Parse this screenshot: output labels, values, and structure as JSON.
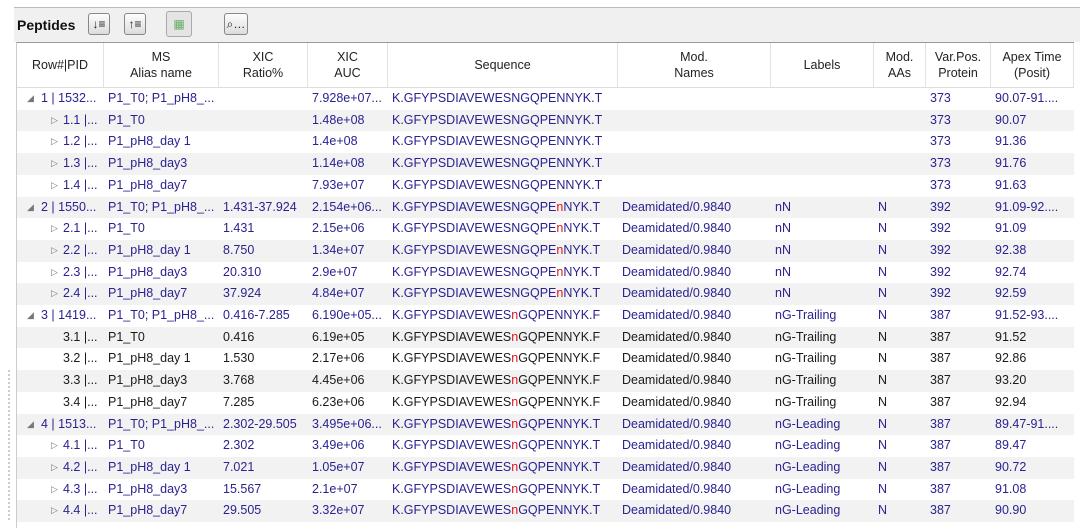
{
  "panel": {
    "title": "Peptides",
    "buttons": [
      {
        "name": "expand-all-button",
        "glyph": "↓≡"
      },
      {
        "name": "collapse-all-button",
        "glyph": "↑≡"
      },
      {
        "name": "export-button",
        "glyph": "▦"
      },
      {
        "name": "find-button",
        "glyph": "⌕…"
      }
    ]
  },
  "columns": [
    "Row#|PID",
    "MS\nAlias name",
    "XIC\nRatio%",
    "XIC\nAUC",
    "Sequence",
    "Mod.\nNames",
    "Labels",
    "Mod.\nAAs",
    "Var.Pos.\nProtein",
    "Apex Time\n(Posit)"
  ],
  "colors": {
    "text": "#2a2290",
    "mod": "#e0141e"
  },
  "rows": [
    {
      "level": 0,
      "expanded": true,
      "id": "1 | 1532...",
      "alias": "P1_T0; P1_pH8_...",
      "ratio": "",
      "auc": "7.928e+07...",
      "seq_pre": "K.GFYPSDIAVEWESNGQPENNYK.T",
      "seq_mod": "",
      "seq_post": "",
      "modnames": "",
      "labels": "",
      "modaas": "",
      "varpos": "373",
      "apex": "90.07-91...."
    },
    {
      "level": 1,
      "id": "1.1 |...",
      "alias": "P1_T0",
      "ratio": "",
      "auc": "1.48e+08",
      "seq_pre": "K.GFYPSDIAVEWESNGQPENNYK.T",
      "seq_mod": "",
      "seq_post": "",
      "modnames": "",
      "labels": "",
      "modaas": "",
      "varpos": "373",
      "apex": "90.07"
    },
    {
      "level": 1,
      "id": "1.2 |...",
      "alias": "P1_pH8_day 1",
      "ratio": "",
      "auc": "1.4e+08",
      "seq_pre": "K.GFYPSDIAVEWESNGQPENNYK.T",
      "seq_mod": "",
      "seq_post": "",
      "modnames": "",
      "labels": "",
      "modaas": "",
      "varpos": "373",
      "apex": "91.36"
    },
    {
      "level": 1,
      "id": "1.3 |...",
      "alias": "P1_pH8_day3",
      "ratio": "",
      "auc": "1.14e+08",
      "seq_pre": "K.GFYPSDIAVEWESNGQPENNYK.T",
      "seq_mod": "",
      "seq_post": "",
      "modnames": "",
      "labels": "",
      "modaas": "",
      "varpos": "373",
      "apex": "91.76"
    },
    {
      "level": 1,
      "id": "1.4 |...",
      "alias": "P1_pH8_day7",
      "ratio": "",
      "auc": "7.93e+07",
      "seq_pre": "K.GFYPSDIAVEWESNGQPENNYK.T",
      "seq_mod": "",
      "seq_post": "",
      "modnames": "",
      "labels": "",
      "modaas": "",
      "varpos": "373",
      "apex": "91.63"
    },
    {
      "level": 0,
      "expanded": true,
      "id": "2 | 1550...",
      "alias": "P1_T0; P1_pH8_...",
      "ratio": "1.431-37.924",
      "auc": "2.154e+06...",
      "seq_pre": "K.GFYPSDIAVEWESNGQPE",
      "seq_mod": "n",
      "seq_post": "NYK.T",
      "modnames": "Deamidated/0.9840",
      "labels": "nN",
      "modaas": "N",
      "varpos": "392",
      "apex": "91.09-92...."
    },
    {
      "level": 1,
      "id": "2.1 |...",
      "alias": "P1_T0",
      "ratio": "1.431",
      "auc": "2.15e+06",
      "seq_pre": "K.GFYPSDIAVEWESNGQPE",
      "seq_mod": "n",
      "seq_post": "NYK.T",
      "modnames": "Deamidated/0.9840",
      "labels": "nN",
      "modaas": "N",
      "varpos": "392",
      "apex": "91.09"
    },
    {
      "level": 1,
      "id": "2.2 |...",
      "alias": "P1_pH8_day 1",
      "ratio": "8.750",
      "auc": "1.34e+07",
      "seq_pre": "K.GFYPSDIAVEWESNGQPE",
      "seq_mod": "n",
      "seq_post": "NYK.T",
      "modnames": "Deamidated/0.9840",
      "labels": "nN",
      "modaas": "N",
      "varpos": "392",
      "apex": "92.38"
    },
    {
      "level": 1,
      "id": "2.3 |...",
      "alias": "P1_pH8_day3",
      "ratio": "20.310",
      "auc": "2.9e+07",
      "seq_pre": "K.GFYPSDIAVEWESNGQPE",
      "seq_mod": "n",
      "seq_post": "NYK.T",
      "modnames": "Deamidated/0.9840",
      "labels": "nN",
      "modaas": "N",
      "varpos": "392",
      "apex": "92.74"
    },
    {
      "level": 1,
      "id": "2.4 |...",
      "alias": "P1_pH8_day7",
      "ratio": "37.924",
      "auc": "4.84e+07",
      "seq_pre": "K.GFYPSDIAVEWESNGQPE",
      "seq_mod": "n",
      "seq_post": "NYK.T",
      "modnames": "Deamidated/0.9840",
      "labels": "nN",
      "modaas": "N",
      "varpos": "392",
      "apex": "92.59"
    },
    {
      "level": 0,
      "expanded": true,
      "id": "3 | 1419...",
      "alias": "P1_T0; P1_pH8_...",
      "ratio": "0.416-7.285",
      "auc": "6.190e+05...",
      "seq_pre": "K.GFYPSDIAVEWES",
      "seq_mod": "n",
      "seq_post": "GQPENNYK.F",
      "modnames": "Deamidated/0.9840",
      "labels": "nG-Trailing",
      "modaas": "N",
      "varpos": "387",
      "apex": "91.52-93...."
    },
    {
      "level": 1,
      "black": true,
      "noarrow": true,
      "id": "3.1 |...",
      "alias": "P1_T0",
      "ratio": "0.416",
      "auc": "6.19e+05",
      "seq_pre": "K.GFYPSDIAVEWES",
      "seq_mod": "n",
      "seq_post": "GQPENNYK.F",
      "modnames": "Deamidated/0.9840",
      "labels": "nG-Trailing",
      "modaas": "N",
      "varpos": "387",
      "apex": "91.52"
    },
    {
      "level": 1,
      "black": true,
      "noarrow": true,
      "id": "3.2 |...",
      "alias": "P1_pH8_day 1",
      "ratio": "1.530",
      "auc": "2.17e+06",
      "seq_pre": "K.GFYPSDIAVEWES",
      "seq_mod": "n",
      "seq_post": "GQPENNYK.F",
      "modnames": "Deamidated/0.9840",
      "labels": "nG-Trailing",
      "modaas": "N",
      "varpos": "387",
      "apex": "92.86"
    },
    {
      "level": 1,
      "black": true,
      "noarrow": true,
      "id": "3.3 |...",
      "alias": "P1_pH8_day3",
      "ratio": "3.768",
      "auc": "4.45e+06",
      "seq_pre": "K.GFYPSDIAVEWES",
      "seq_mod": "n",
      "seq_post": "GQPENNYK.F",
      "modnames": "Deamidated/0.9840",
      "labels": "nG-Trailing",
      "modaas": "N",
      "varpos": "387",
      "apex": "93.20"
    },
    {
      "level": 1,
      "black": true,
      "noarrow": true,
      "id": "3.4 |...",
      "alias": "P1_pH8_day7",
      "ratio": "7.285",
      "auc": "6.23e+06",
      "seq_pre": "K.GFYPSDIAVEWES",
      "seq_mod": "n",
      "seq_post": "GQPENNYK.F",
      "modnames": "Deamidated/0.9840",
      "labels": "nG-Trailing",
      "modaas": "N",
      "varpos": "387",
      "apex": "92.94"
    },
    {
      "level": 0,
      "expanded": true,
      "id": "4 | 1513...",
      "alias": "P1_T0; P1_pH8_...",
      "ratio": "2.302-29.505",
      "auc": "3.495e+06...",
      "seq_pre": "K.GFYPSDIAVEWES",
      "seq_mod": "n",
      "seq_post": "GQPENNYK.T",
      "modnames": "Deamidated/0.9840",
      "labels": "nG-Leading",
      "modaas": "N",
      "varpos": "387",
      "apex": "89.47-91...."
    },
    {
      "level": 1,
      "id": "4.1 |...",
      "alias": "P1_T0",
      "ratio": "2.302",
      "auc": "3.49e+06",
      "seq_pre": "K.GFYPSDIAVEWES",
      "seq_mod": "n",
      "seq_post": "GQPENNYK.T",
      "modnames": "Deamidated/0.9840",
      "labels": "nG-Leading",
      "modaas": "N",
      "varpos": "387",
      "apex": "89.47"
    },
    {
      "level": 1,
      "id": "4.2 |...",
      "alias": "P1_pH8_day 1",
      "ratio": "7.021",
      "auc": "1.05e+07",
      "seq_pre": "K.GFYPSDIAVEWES",
      "seq_mod": "n",
      "seq_post": "GQPENNYK.T",
      "modnames": "Deamidated/0.9840",
      "labels": "nG-Leading",
      "modaas": "N",
      "varpos": "387",
      "apex": "90.72"
    },
    {
      "level": 1,
      "id": "4.3 |...",
      "alias": "P1_pH8_day3",
      "ratio": "15.567",
      "auc": "2.1e+07",
      "seq_pre": "K.GFYPSDIAVEWES",
      "seq_mod": "n",
      "seq_post": "GQPENNYK.T",
      "modnames": "Deamidated/0.9840",
      "labels": "nG-Leading",
      "modaas": "N",
      "varpos": "387",
      "apex": "91.08"
    },
    {
      "level": 1,
      "id": "4.4 |...",
      "alias": "P1_pH8_day7",
      "ratio": "29.505",
      "auc": "3.32e+07",
      "seq_pre": "K.GFYPSDIAVEWES",
      "seq_mod": "n",
      "seq_post": "GQPENNYK.T",
      "modnames": "Deamidated/0.9840",
      "labels": "nG-Leading",
      "modaas": "N",
      "varpos": "387",
      "apex": "90.90"
    }
  ]
}
